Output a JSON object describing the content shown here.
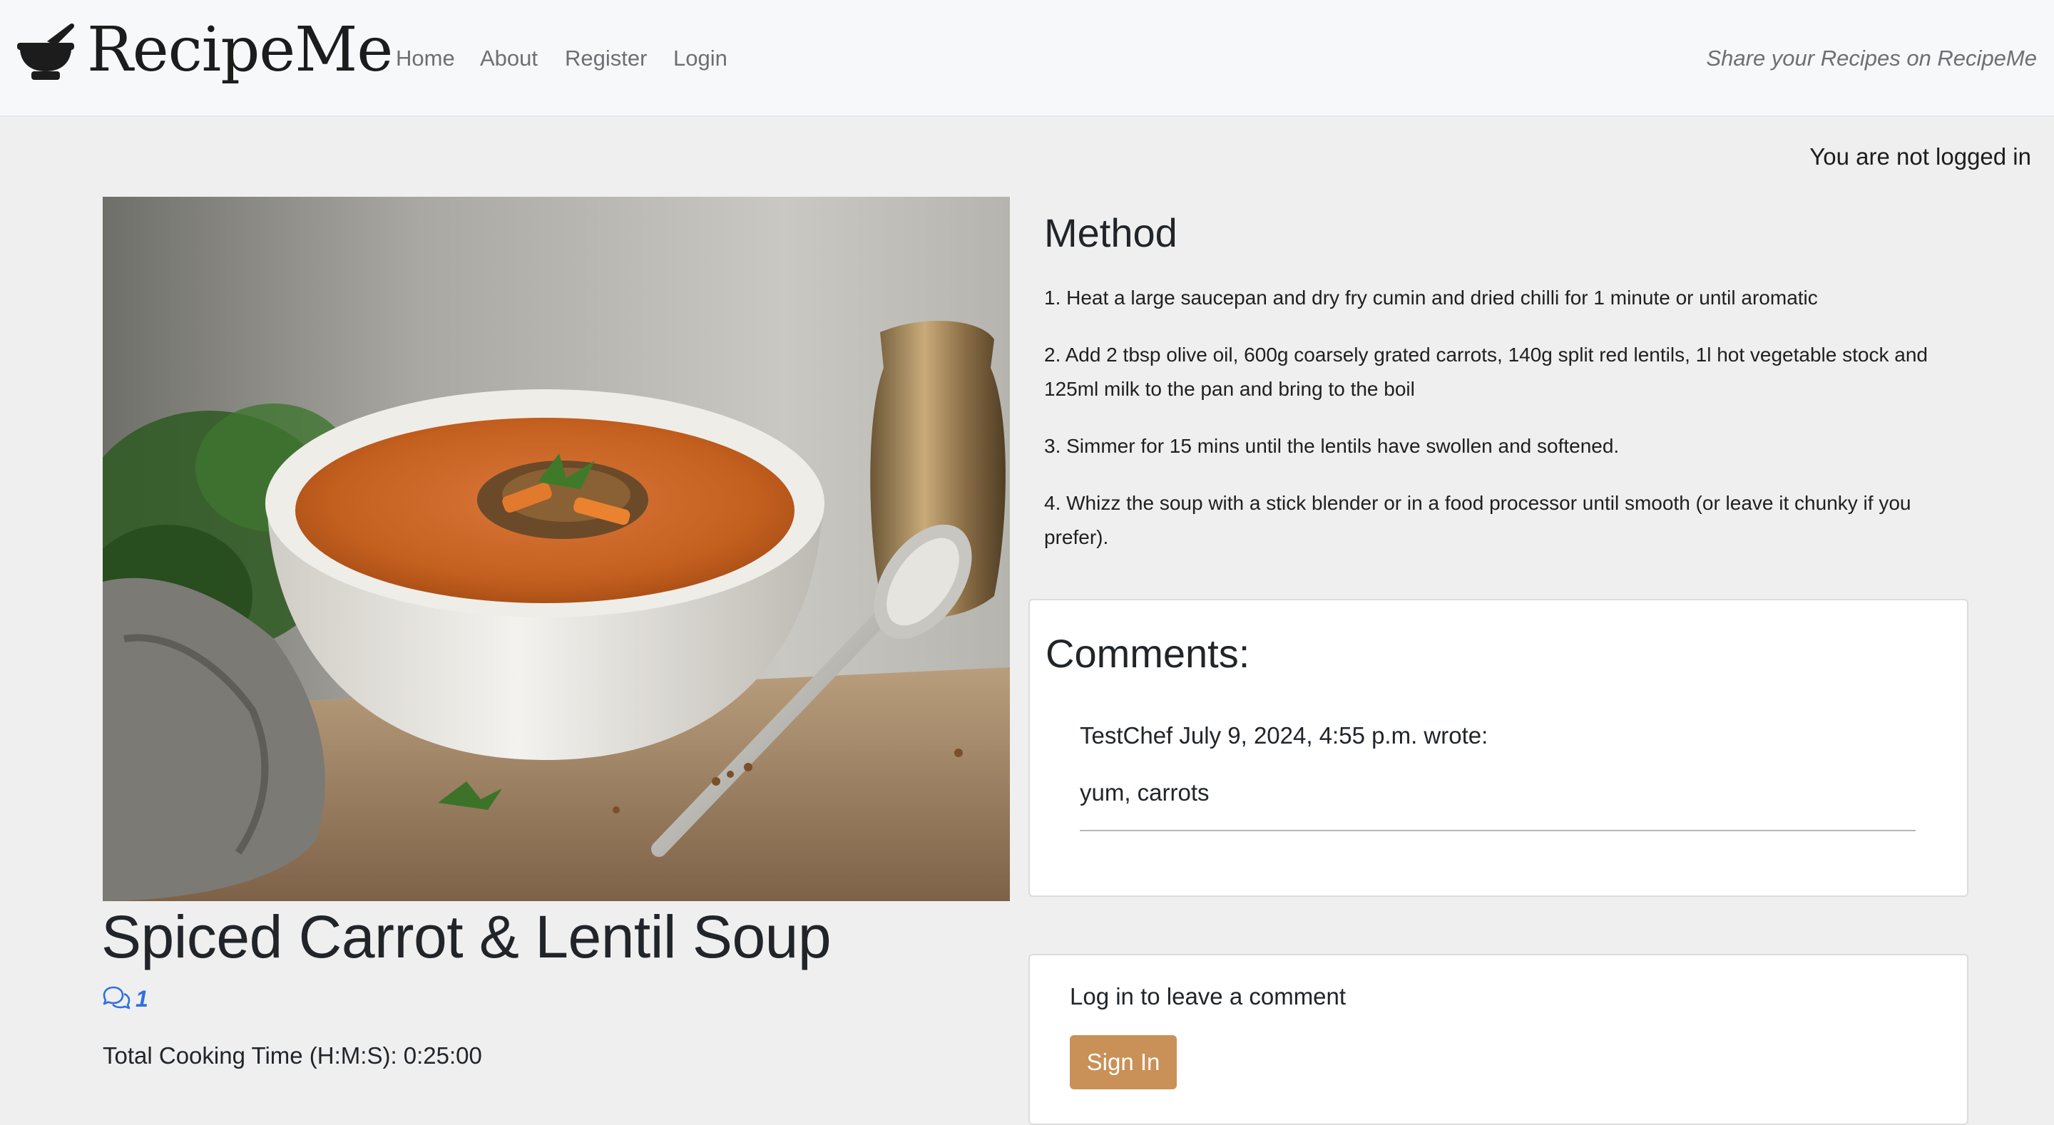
{
  "nav": {
    "brand": "RecipeMe",
    "links": [
      "Home",
      "About",
      "Register",
      "Login"
    ],
    "tagline": "Share your Recipes on RecipeMe"
  },
  "auth_status": "You are not logged in",
  "recipe": {
    "title": "Spiced Carrot & Lentil Soup",
    "comment_count": "1",
    "cooking_time": "Total Cooking Time (H:M:S): 0:25:00",
    "method_heading": "Method",
    "method": [
      "1. Heat a large saucepan and dry fry cumin and dried chilli for 1 minute or until aromatic",
      "2. Add 2 tbsp olive oil, 600g coarsely grated carrots, 140g split red lentils, 1l hot vegetable stock and 125ml milk to the pan and bring to the boil",
      "3. Simmer for 15 mins until the lentils have swollen and softened.",
      "4. Whizz the soup with a stick blender or in a food processor until smooth (or leave it chunky if you prefer)."
    ]
  },
  "comments": {
    "heading": "Comments:",
    "items": [
      {
        "meta": "TestChef July 9, 2024, 4:55 p.m. wrote:",
        "body": "yum, carrots"
      }
    ]
  },
  "comment_form": {
    "prompt": "Log in to leave a comment",
    "signin_label": "Sign In"
  },
  "colors": {
    "accent_button": "#c99057",
    "link_blue": "#2f6fe0",
    "page_bg": "#efefef",
    "navbar_bg": "#f7f8fa"
  },
  "icons": {
    "brand": "mortar-pestle-icon",
    "comments": "comments-icon"
  }
}
